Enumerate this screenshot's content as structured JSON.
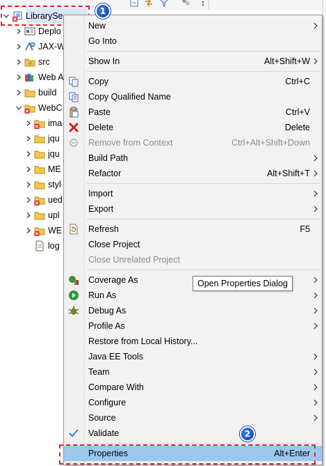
{
  "project_explorer": {
    "root": {
      "label": "LibrarySe…",
      "expanded": true
    },
    "items": [
      {
        "label": "Deplo",
        "icon": "deployment-descriptor-icon",
        "indent": 1,
        "arrow": "right"
      },
      {
        "label": "JAX-W",
        "icon": "jax-ws-icon",
        "indent": 1,
        "arrow": "right"
      },
      {
        "label": "src",
        "icon": "source-folder-icon",
        "indent": 1,
        "arrow": "right"
      },
      {
        "label": "Web A",
        "icon": "web-app-libraries-icon",
        "indent": 1,
        "arrow": "right"
      },
      {
        "label": "build",
        "icon": "folder-icon",
        "indent": 1,
        "arrow": "right"
      },
      {
        "label": "WebC",
        "icon": "webcontent-folder-icon",
        "indent": 1,
        "arrow": "down"
      },
      {
        "label": "ima",
        "icon": "folder-error-icon",
        "indent": 2,
        "arrow": "right"
      },
      {
        "label": "jqu",
        "icon": "folder-icon",
        "indent": 2,
        "arrow": "right"
      },
      {
        "label": "jqu",
        "icon": "folder-icon",
        "indent": 2,
        "arrow": "right"
      },
      {
        "label": "ME",
        "icon": "folder-icon",
        "indent": 2,
        "arrow": "right"
      },
      {
        "label": "styl",
        "icon": "folder-icon",
        "indent": 2,
        "arrow": "right"
      },
      {
        "label": "ued",
        "icon": "folder-error-icon",
        "indent": 2,
        "arrow": "right"
      },
      {
        "label": "upl",
        "icon": "folder-icon",
        "indent": 2,
        "arrow": "right"
      },
      {
        "label": "WE",
        "icon": "folder-error-icon",
        "indent": 2,
        "arrow": "right"
      },
      {
        "label": "log",
        "icon": "jsp-file-icon",
        "indent": 2,
        "arrow": "none"
      }
    ]
  },
  "badges": {
    "step1": "1",
    "step2": "2"
  },
  "context_menu": {
    "items": [
      {
        "label": "New",
        "shortcut": "",
        "submenu": true,
        "icon": "",
        "disabled": false
      },
      {
        "label": "Go Into",
        "shortcut": "",
        "submenu": false,
        "icon": "",
        "disabled": false
      },
      {
        "separator": true
      },
      {
        "label": "Show In",
        "shortcut": "Alt+Shift+W",
        "submenu": true,
        "icon": "",
        "disabled": false
      },
      {
        "separator": true
      },
      {
        "label": "Copy",
        "shortcut": "Ctrl+C",
        "submenu": false,
        "icon": "copy-icon",
        "disabled": false
      },
      {
        "label": "Copy Qualified Name",
        "shortcut": "",
        "submenu": false,
        "icon": "copy-qualified-name-icon",
        "disabled": false
      },
      {
        "label": "Paste",
        "shortcut": "Ctrl+V",
        "submenu": false,
        "icon": "paste-icon",
        "disabled": false
      },
      {
        "label": "Delete",
        "shortcut": "Delete",
        "submenu": false,
        "icon": "delete-icon",
        "disabled": false
      },
      {
        "label": "Remove from Context",
        "shortcut": "Ctrl+Alt+Shift+Down",
        "submenu": false,
        "icon": "remove-from-context-icon",
        "disabled": true
      },
      {
        "label": "Build Path",
        "shortcut": "",
        "submenu": true,
        "icon": "",
        "disabled": false
      },
      {
        "label": "Refactor",
        "shortcut": "Alt+Shift+T",
        "submenu": true,
        "icon": "",
        "disabled": false
      },
      {
        "separator": true
      },
      {
        "label": "Import",
        "shortcut": "",
        "submenu": true,
        "icon": "",
        "disabled": false
      },
      {
        "label": "Export",
        "shortcut": "",
        "submenu": true,
        "icon": "",
        "disabled": false
      },
      {
        "separator": true
      },
      {
        "label": "Refresh",
        "shortcut": "F5",
        "submenu": false,
        "icon": "refresh-icon",
        "disabled": false
      },
      {
        "label": "Close Project",
        "shortcut": "",
        "submenu": false,
        "icon": "",
        "disabled": false
      },
      {
        "label": "Close Unrelated Project",
        "shortcut": "",
        "submenu": false,
        "icon": "",
        "disabled": true
      },
      {
        "separator": true
      },
      {
        "label": "Coverage As",
        "shortcut": "",
        "submenu": true,
        "icon": "coverage-icon",
        "disabled": false
      },
      {
        "label": "Run As",
        "shortcut": "",
        "submenu": true,
        "icon": "run-icon",
        "disabled": false
      },
      {
        "label": "Debug As",
        "shortcut": "",
        "submenu": true,
        "icon": "debug-icon",
        "disabled": false
      },
      {
        "label": "Profile As",
        "shortcut": "",
        "submenu": true,
        "icon": "",
        "disabled": false
      },
      {
        "label": "Restore from Local History...",
        "shortcut": "",
        "submenu": false,
        "icon": "",
        "disabled": false
      },
      {
        "label": "Java EE Tools",
        "shortcut": "",
        "submenu": true,
        "icon": "",
        "disabled": false
      },
      {
        "label": "Team",
        "shortcut": "",
        "submenu": true,
        "icon": "",
        "disabled": false
      },
      {
        "label": "Compare With",
        "shortcut": "",
        "submenu": true,
        "icon": "",
        "disabled": false
      },
      {
        "label": "Configure",
        "shortcut": "",
        "submenu": true,
        "icon": "",
        "disabled": false
      },
      {
        "label": "Source",
        "shortcut": "",
        "submenu": true,
        "icon": "",
        "disabled": false
      },
      {
        "label": "Validate",
        "shortcut": "",
        "submenu": false,
        "icon": "validate-check-icon",
        "disabled": false
      },
      {
        "separator": true
      },
      {
        "label": "Properties",
        "shortcut": "Alt+Enter",
        "submenu": false,
        "icon": "",
        "disabled": false,
        "highlighted": true
      }
    ]
  },
  "tooltip": {
    "text": "Open Properties Dialog"
  },
  "colors": {
    "menu_bg": "#f2f2f2",
    "highlight": "#9cc8f0",
    "annotation_red": "#e02020",
    "badge_blue": "#0b3fa8",
    "disabled_text": "#8c8c8c"
  }
}
